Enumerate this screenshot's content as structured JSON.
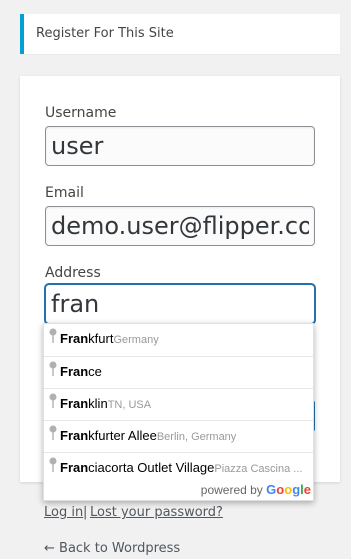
{
  "notice": {
    "text": "Register For This Site"
  },
  "form": {
    "username": {
      "label": "Username",
      "value": "user"
    },
    "email": {
      "label": "Email",
      "value": "demo.user@flipper.com"
    },
    "address": {
      "label": "Address",
      "value": "fran"
    }
  },
  "autocomplete": {
    "items": [
      {
        "match": "Fran",
        "rest": "kfurt",
        "secondary": "Germany"
      },
      {
        "match": "Fran",
        "rest": "ce",
        "secondary": ""
      },
      {
        "match": "Fran",
        "rest": "klin",
        "secondary": "TN, USA"
      },
      {
        "match": "Fran",
        "rest": "kfurter Allee",
        "secondary": "Berlin, Germany"
      },
      {
        "match": "Fran",
        "rest": "ciacorta Outlet Village",
        "secondary": "Piazza Cascina ..."
      }
    ],
    "powered_by": "powered by",
    "google_letters": [
      "G",
      "o",
      "o",
      "g",
      "l",
      "e"
    ],
    "google_colors": [
      "#4285F4",
      "#EA4335",
      "#FBBC05",
      "#4285F4",
      "#34A853",
      "#EA4335"
    ]
  },
  "links": {
    "login": "Log in",
    "separator": "|",
    "lost_password": "Lost your password?",
    "back": "← Back to Wordpress"
  },
  "colors": {
    "accent": "#00a0d2",
    "primary_button": "#2271b1"
  }
}
